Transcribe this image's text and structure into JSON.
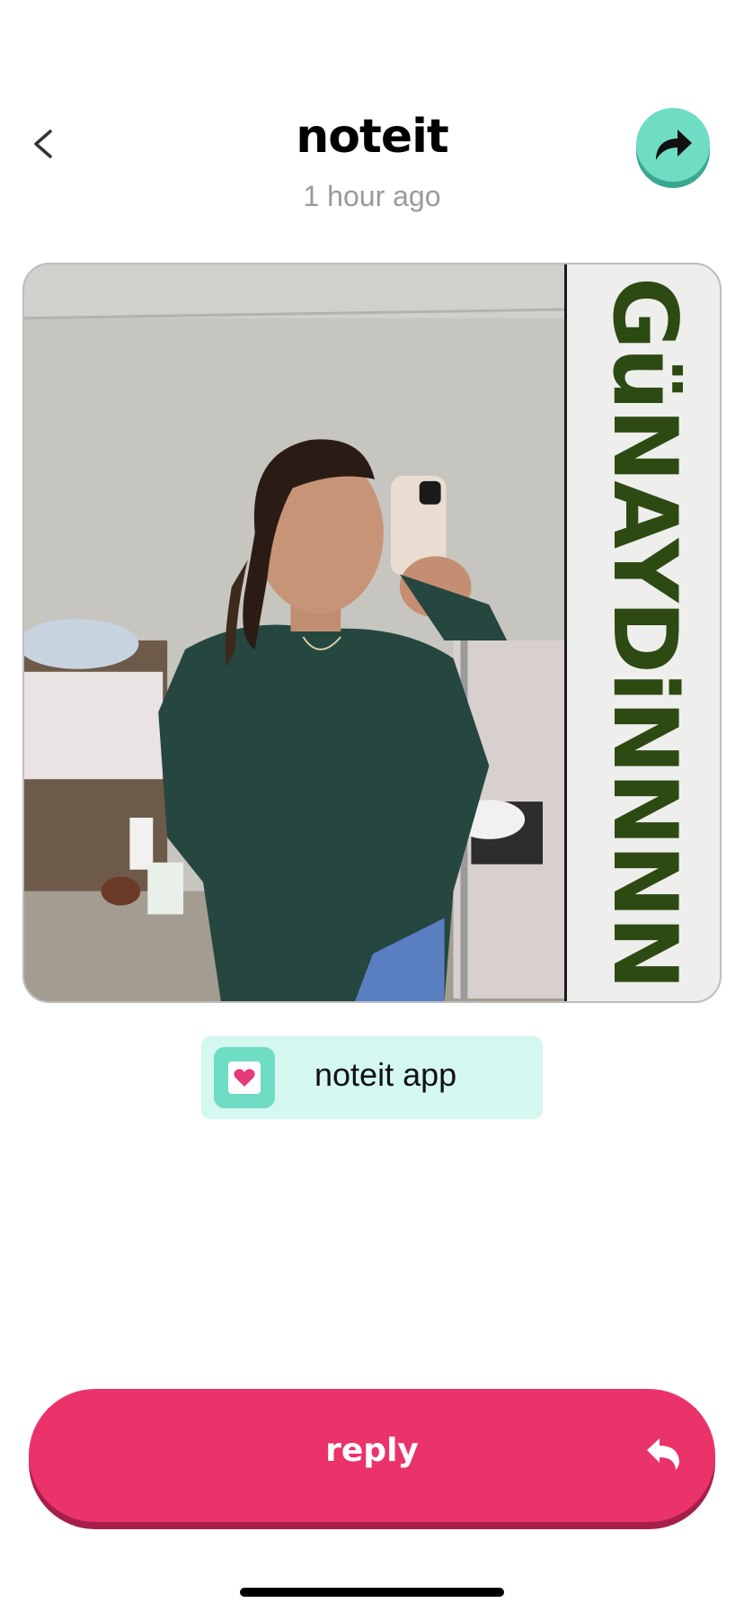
{
  "header": {
    "title": "noteit",
    "timestamp": "1 hour ago",
    "back_icon": "chevron-left-icon",
    "share_icon": "share-arrow-icon"
  },
  "photo": {
    "caption_text": "GüNAYDiNNNN",
    "description_icon": "photo"
  },
  "app_chip": {
    "label": "noteit app",
    "icon": "heart-note-icon"
  },
  "reply": {
    "label": "reply",
    "icon": "reply-arrow-icon"
  },
  "colors": {
    "accent_teal": "#6fdcc4",
    "chip_background": "#d4f7ef",
    "reply_pink": "#ea336b",
    "caption_green": "#2d4a12",
    "timestamp_gray": "#9a9a9a"
  }
}
